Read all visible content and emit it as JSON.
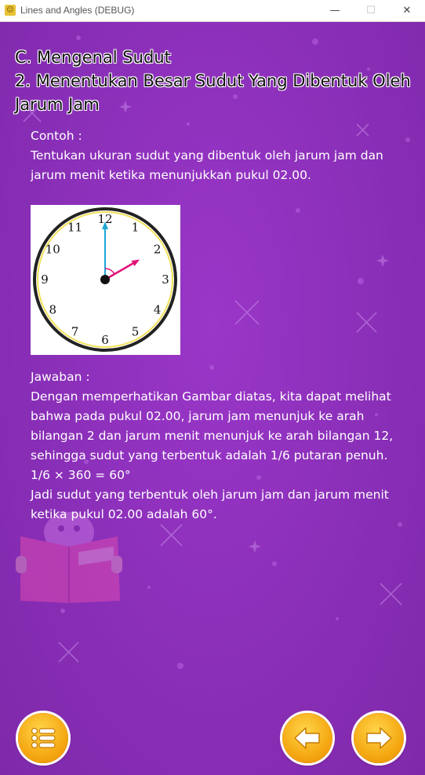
{
  "window": {
    "title": "Lines and Angles (DEBUG)",
    "minimize_glyph": "—",
    "maximize_glyph": "☐",
    "close_glyph": "✕"
  },
  "heading": {
    "line1": "C. Mengenal Sudut",
    "line2": "2. Menentukan Besar Sudut Yang Dibentuk Oleh",
    "line3": "Jarum Jam"
  },
  "example": {
    "label": "Contoh :",
    "line1": "Tentukan ukuran sudut yang dibentuk oleh jarum jam dan",
    "line2": "jarum menit ketika menunjukkan pukul 02.00."
  },
  "clock": {
    "numbers": [
      "12",
      "1",
      "2",
      "3",
      "4",
      "5",
      "6",
      "7",
      "8",
      "9",
      "10",
      "11"
    ],
    "hour": 2,
    "minute": 0,
    "minute_hand_color": "#1ea7d6",
    "hour_hand_color": "#e0147a",
    "rim_color": "#f2e15a"
  },
  "answer": {
    "label": "Jawaban :",
    "lines": [
      "Dengan memperhatikan Gambar diatas, kita dapat melihat",
      "bahwa pada pukul 02.00, jarum jam menunjuk ke arah",
      "bilangan 2 dan jarum menit menunjuk ke arah bilangan 12,",
      "sehingga sudut yang terbentuk adalah 1/6 putaran penuh.",
      "1/6 × 360 = 60°",
      "Jadi sudut yang terbentuk oleh jarum jam dan jarum menit",
      "ketika pukul 02.00 adalah 60°."
    ]
  },
  "nav": {
    "menu_icon": "list-icon",
    "prev_icon": "arrow-left-icon",
    "next_icon": "arrow-right-icon"
  },
  "colors": {
    "background": "#8a2fb8",
    "button": "#f5a812"
  }
}
